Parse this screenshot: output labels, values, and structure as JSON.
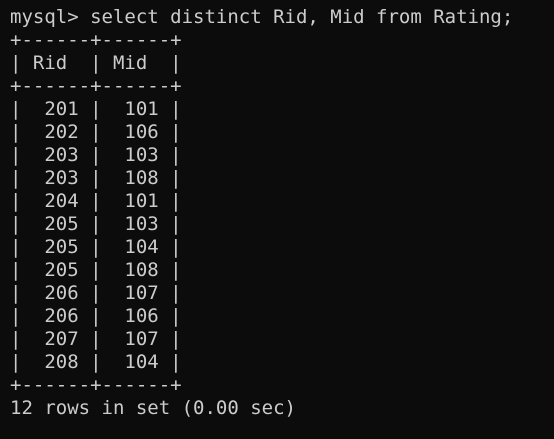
{
  "terminal": {
    "command_line": "mysql> select distinct Rid, Mid from Rating;",
    "border": "+------+------+",
    "header": "| Rid  | Mid  |",
    "rows": [
      "|  201 |  101 |",
      "|  202 |  106 |",
      "|  203 |  103 |",
      "|  203 |  108 |",
      "|  204 |  101 |",
      "|  205 |  103 |",
      "|  205 |  104 |",
      "|  205 |  108 |",
      "|  206 |  107 |",
      "|  206 |  106 |",
      "|  207 |  107 |",
      "|  208 |  104 |"
    ],
    "footer": "12 rows in set (0.00 sec)"
  }
}
